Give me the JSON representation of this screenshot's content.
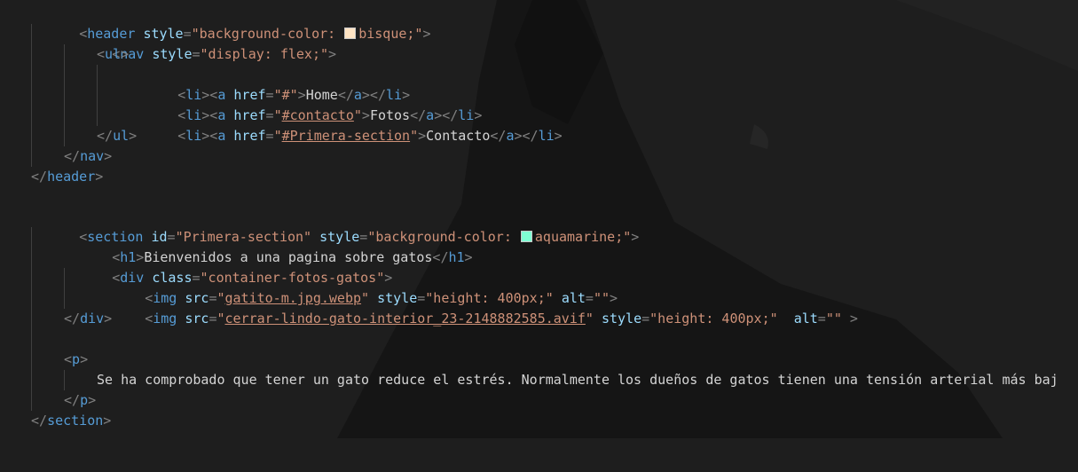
{
  "code": {
    "header_open": {
      "attr": "style",
      "value_before": "\"background-color: ",
      "color_name": "bisque",
      "value_after": ";\"",
      "swatch_color": "#ffe4c4"
    },
    "nav_open": {
      "attr": "style",
      "value": "\"display: flex;\""
    },
    "li1": {
      "href": "\"#\"",
      "text": "Home"
    },
    "li2": {
      "href_q1": "\"",
      "href": "#contacto",
      "href_q2": "\"",
      "text": "Fotos"
    },
    "li3": {
      "href_q1": "\"",
      "href": "#Primera-section",
      "href_q2": "\"",
      "text": "Contacto"
    },
    "section_open": {
      "id_attr": "id",
      "id_value": "\"Primera-section\"",
      "style_attr": "style",
      "value_before": "\"background-color: ",
      "color_name": "aquamarine",
      "value_after": ";\"",
      "swatch_color": "#7fffd4"
    },
    "h1_text": "Bienvenidos a una pagina sobre gatos",
    "div_open": {
      "attr": "class",
      "value": "\"container-fotos-gatos\""
    },
    "img1": {
      "src_q1": "\"",
      "src": "gatito-m.jpg.webp",
      "src_q2": "\"",
      "style_value": "\"height: 400px;\"",
      "alt_value": "\"\""
    },
    "img2": {
      "src_q1": "\"",
      "src": "cerrar-lindo-gato-interior_23-2148882585.avif",
      "src_q2": "\"",
      "style_value": "\"height: 400px;\"",
      "alt_value": "\"\""
    },
    "p_text": "Se ha comprobado que tener un gato reduce el estrés. Normalmente los dueños de gatos tienen una tensión arterial más baj"
  },
  "theme": {
    "background": "#1e1e1e",
    "tag": "#569cd6",
    "attribute": "#9cdcfe",
    "string": "#ce9178",
    "text": "#d4d4d4",
    "bracket": "#808080"
  }
}
